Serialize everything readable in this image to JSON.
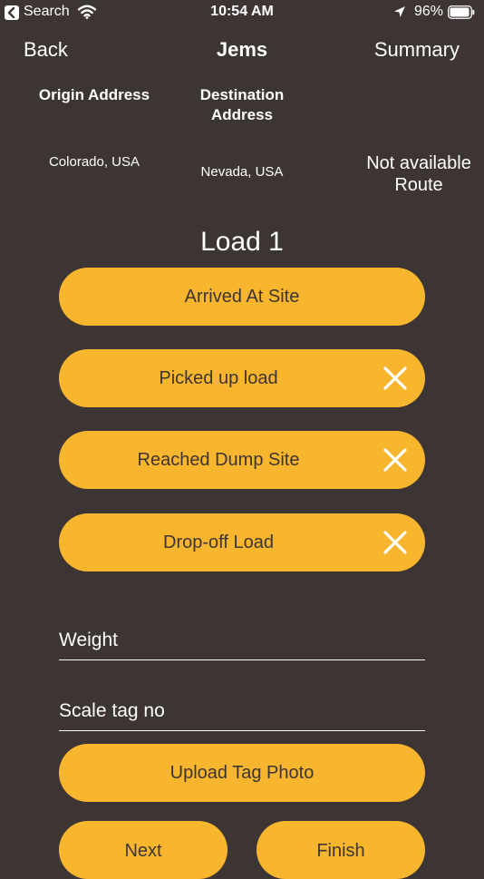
{
  "status_bar": {
    "carrier": "Search",
    "time": "10:54 AM",
    "battery_percent": "96%",
    "battery_level": 0.96
  },
  "nav": {
    "back_label": "Back",
    "title": "Jems",
    "summary_label": "Summary"
  },
  "addresses": {
    "origin_label": "Origin Address",
    "destination_label": "Destination Address",
    "origin_value": "Colorado, USA",
    "destination_value": "Nevada, USA",
    "route_value": "Not available Route"
  },
  "load": {
    "title": "Load 1",
    "arrived_label": "Arrived At Site",
    "picked_label": "Picked up load",
    "reached_label": "Reached Dump Site",
    "dropoff_label": "Drop-off Load"
  },
  "form": {
    "weight_placeholder": "Weight",
    "scale_placeholder": "Scale tag no",
    "upload_label": "Upload Tag Photo"
  },
  "footer": {
    "next_label": "Next",
    "finish_label": "Finish"
  },
  "colors": {
    "background": "#3d3533",
    "accent": "#f8b52e",
    "button_text": "#3d3533"
  },
  "icons": [
    "back-to-app-icon",
    "wifi-icon",
    "location-arrow-icon",
    "battery-icon",
    "close-icon"
  ]
}
